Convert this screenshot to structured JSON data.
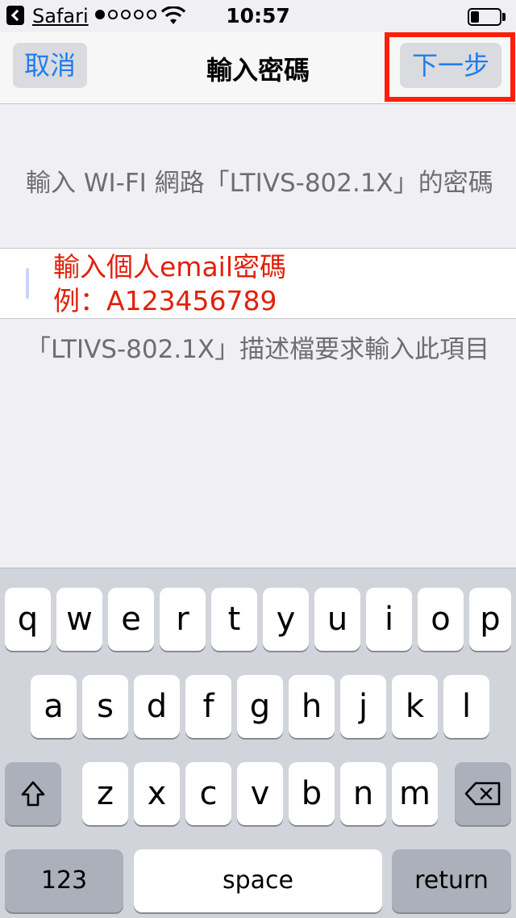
{
  "status_bar": {
    "back_app": "Safari",
    "time": "10:57",
    "signal_bars_filled": 1,
    "signal_bars_total": 5
  },
  "nav": {
    "cancel": "取消",
    "title": "輸入密碼",
    "next": "下一步"
  },
  "content": {
    "prompt": "輸入 WI-FI 網路「LTIVS-802.1X」的密碼",
    "hint_line1": "輸入個人email密碼",
    "hint_line2": "例：A123456789",
    "footer": "「LTIVS-802.1X」描述檔要求輸入此項目"
  },
  "keyboard": {
    "row1": [
      "q",
      "w",
      "e",
      "r",
      "t",
      "y",
      "u",
      "i",
      "o",
      "p"
    ],
    "row2": [
      "a",
      "s",
      "d",
      "f",
      "g",
      "h",
      "j",
      "k",
      "l"
    ],
    "row3": [
      "z",
      "x",
      "c",
      "v",
      "b",
      "n",
      "m"
    ],
    "numbers_key": "123",
    "space_key": "space",
    "return_key": "return"
  },
  "colors": {
    "accent": "#1f7cf0",
    "highlight": "#ff1e0b",
    "hint": "#e1200a"
  }
}
